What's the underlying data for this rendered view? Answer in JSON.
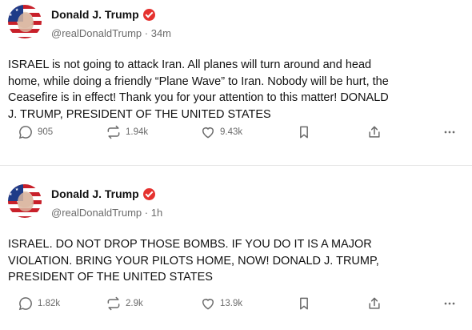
{
  "posts": [
    {
      "author": "Donald J. Trump",
      "handle": "@realDonaldTrump",
      "time": "34m",
      "text": "ISRAEL is not going to attack Iran. All planes will turn around and head\nhome, while doing a friendly “Plane Wave” to Iran. Nobody will be hurt, the\nCeasefire is in effect! Thank you for your attention to this matter! DONALD\nJ. TRUMP, PRESIDENT OF THE UNITED STATES",
      "replies": "905",
      "restates": "1.94k",
      "likes": "9.43k"
    },
    {
      "author": "Donald J. Trump",
      "handle": "@realDonaldTrump",
      "time": "1h",
      "text": "ISRAEL. DO NOT DROP THOSE BOMBS. IF YOU DO IT IS A MAJOR\nVIOLATION. BRING YOUR PILOTS HOME, NOW!  DONALD J. TRUMP,\nPRESIDENT OF THE UNITED STATES",
      "replies": "1.82k",
      "restates": "2.9k",
      "likes": "13.9k"
    }
  ],
  "separator": " · ",
  "colors": {
    "verified": "#e5322f",
    "muted": "#6b6b6b",
    "text": "#111111"
  },
  "icons": [
    "reply-icon",
    "restate-icon",
    "like-icon",
    "bookmark-icon",
    "share-icon",
    "more-icon"
  ]
}
